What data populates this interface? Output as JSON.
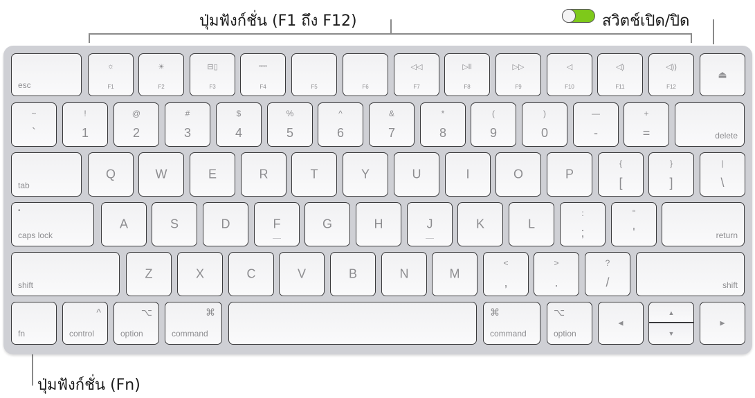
{
  "callouts": {
    "function_keys": "ปุ่มฟังก์ชั่น (F1 ถึง F12)",
    "power_switch": "สวิตช์เปิด/ปิด",
    "fn_key": "ปุ่มฟังก์ชั่น (Fn)"
  },
  "toggle": {
    "state": "on",
    "color": "#7ec91a"
  },
  "rows": {
    "fn_row": [
      {
        "label": "esc"
      },
      {
        "label": "F1",
        "icon": "☼",
        "icon_name": "brightness-down-icon"
      },
      {
        "label": "F2",
        "icon": "☀",
        "icon_name": "brightness-up-icon"
      },
      {
        "label": "F3",
        "icon": "⊟▯",
        "icon_name": "mission-control-icon"
      },
      {
        "label": "F4",
        "icon": "▫▫▫",
        "icon_name": "launchpad-icon"
      },
      {
        "label": "F5"
      },
      {
        "label": "F6"
      },
      {
        "label": "F7",
        "icon": "◁◁",
        "icon_name": "rewind-icon"
      },
      {
        "label": "F8",
        "icon": "▷ll",
        "icon_name": "play-pause-icon"
      },
      {
        "label": "F9",
        "icon": "▷▷",
        "icon_name": "fast-forward-icon"
      },
      {
        "label": "F10",
        "icon": "◁",
        "icon_name": "mute-icon"
      },
      {
        "label": "F11",
        "icon": "◁)",
        "icon_name": "volume-down-icon"
      },
      {
        "label": "F12",
        "icon": "◁))",
        "icon_name": "volume-up-icon"
      },
      {
        "label": "⏏",
        "icon_name": "eject-icon"
      }
    ],
    "number_row": [
      {
        "up": "~",
        "dn": "`"
      },
      {
        "up": "!",
        "dn": "1"
      },
      {
        "up": "@",
        "dn": "2"
      },
      {
        "up": "#",
        "dn": "3"
      },
      {
        "up": "$",
        "dn": "4"
      },
      {
        "up": "%",
        "dn": "5"
      },
      {
        "up": "^",
        "dn": "6"
      },
      {
        "up": "&",
        "dn": "7"
      },
      {
        "up": "*",
        "dn": "8"
      },
      {
        "up": "(",
        "dn": "9"
      },
      {
        "up": ")",
        "dn": "0"
      },
      {
        "up": "—",
        "dn": "-"
      },
      {
        "up": "+",
        "dn": "="
      },
      {
        "label": "delete"
      }
    ],
    "top_row": [
      {
        "label": "tab"
      },
      {
        "c": "Q"
      },
      {
        "c": "W"
      },
      {
        "c": "E"
      },
      {
        "c": "R"
      },
      {
        "c": "T"
      },
      {
        "c": "Y"
      },
      {
        "c": "U"
      },
      {
        "c": "I"
      },
      {
        "c": "O"
      },
      {
        "c": "P"
      },
      {
        "up": "{",
        "dn": "["
      },
      {
        "up": "}",
        "dn": "]"
      },
      {
        "up": "|",
        "dn": "\\"
      }
    ],
    "home_row": [
      {
        "label": "caps lock",
        "dot": "•"
      },
      {
        "c": "A"
      },
      {
        "c": "S"
      },
      {
        "c": "D"
      },
      {
        "c": "F"
      },
      {
        "c": "G"
      },
      {
        "c": "H"
      },
      {
        "c": "J"
      },
      {
        "c": "K"
      },
      {
        "c": "L"
      },
      {
        "up": ":",
        "dn": ";"
      },
      {
        "up": "\"",
        "dn": "'"
      },
      {
        "label": "return"
      }
    ],
    "bottom_row": [
      {
        "label": "shift"
      },
      {
        "c": "Z"
      },
      {
        "c": "X"
      },
      {
        "c": "C"
      },
      {
        "c": "V"
      },
      {
        "c": "B"
      },
      {
        "c": "N"
      },
      {
        "c": "M"
      },
      {
        "up": "<",
        "dn": ","
      },
      {
        "up": ">",
        "dn": "."
      },
      {
        "up": "?",
        "dn": "/"
      },
      {
        "label": "shift"
      }
    ],
    "modifier_row": [
      {
        "label": "fn"
      },
      {
        "label": "control",
        "sym": "^"
      },
      {
        "label": "option",
        "sym": "⌥"
      },
      {
        "label": "command",
        "sym": "⌘"
      },
      {
        "label": ""
      },
      {
        "label": "command",
        "sym": "⌘"
      },
      {
        "label": "option",
        "sym": "⌥"
      },
      {
        "arrow": "◀"
      },
      {
        "arrow_up": "▲",
        "arrow_down": "▼"
      },
      {
        "arrow": "▶"
      }
    ]
  }
}
